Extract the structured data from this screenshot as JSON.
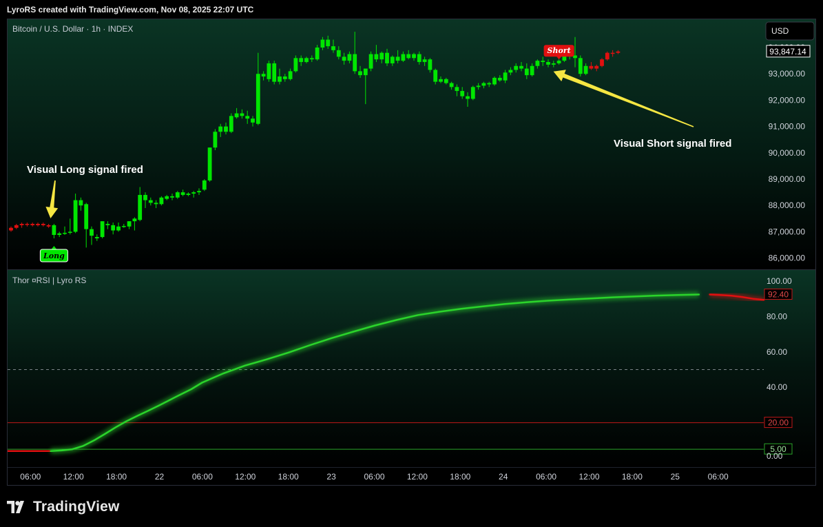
{
  "header": {
    "credit": "LyroRS created with TradingView.com, Nov 08, 2025 22:07 UTC"
  },
  "footer": {
    "brand": "TradingView",
    "logo_icon": "tradingview-logo-icon"
  },
  "colors": {
    "bull": "#00e600",
    "bear": "#e01010",
    "price_label_border": "#ffffff",
    "rsi_green": "#2bd42b",
    "rsi_red": "#e01010",
    "level_red": "#c01818",
    "level_green": "#2aa52a",
    "arrow": "#f5e642"
  },
  "chart_data": [
    {
      "type": "candlestick",
      "title": "Bitcoin / U.S. Dollar · 1h · INDEX",
      "currency_button": "USD",
      "last_price_label": "93,847.14",
      "last_price": 93847.14,
      "ylim": [
        85650,
        94550
      ],
      "yticks": [
        86000,
        87000,
        88000,
        89000,
        90000,
        91000,
        92000,
        93000,
        94000
      ],
      "ytick_labels": [
        "86,000.00",
        "87,000.00",
        "88,000.00",
        "89,000.00",
        "90,000.00",
        "91,000.00",
        "92,000.00",
        "93,000.00",
        "94,000.00"
      ],
      "xlim": [
        0,
        140
      ],
      "xticks": [
        4,
        12,
        20,
        28,
        36,
        44,
        52,
        60,
        68,
        76,
        84,
        92,
        100,
        108,
        116,
        124,
        132
      ],
      "xtick_labels": [
        "06:00",
        "12:00",
        "18:00",
        "22",
        "06:00",
        "12:00",
        "18:00",
        "23",
        "06:00",
        "12:00",
        "18:00",
        "24",
        "06:00",
        "12:00",
        "18:00",
        "25",
        "06:00"
      ],
      "candles": [
        [
          87050,
          87200,
          87000,
          87150,
          "r"
        ],
        [
          87150,
          87300,
          87100,
          87250,
          "r"
        ],
        [
          87250,
          87350,
          87150,
          87300,
          "r"
        ],
        [
          87300,
          87350,
          87200,
          87300,
          "r"
        ],
        [
          87300,
          87350,
          87200,
          87250,
          "r"
        ],
        [
          87250,
          87350,
          87200,
          87300,
          "r"
        ],
        [
          87300,
          87350,
          87200,
          87250,
          "r"
        ],
        [
          87250,
          87300,
          87150,
          87200,
          "r"
        ],
        [
          87250,
          87300,
          86750,
          86880,
          "g"
        ],
        [
          86880,
          87000,
          86800,
          86940,
          "g"
        ],
        [
          86920,
          87200,
          86880,
          86960,
          "g"
        ],
        [
          86960,
          87500,
          86900,
          87000,
          "g"
        ],
        [
          87000,
          88450,
          86950,
          88200,
          "g"
        ],
        [
          88200,
          88300,
          87800,
          88000,
          "g"
        ],
        [
          88050,
          88100,
          86400,
          87100,
          "g"
        ],
        [
          87100,
          87200,
          86500,
          86850,
          "g"
        ],
        [
          86750,
          86900,
          86650,
          86800,
          "g"
        ],
        [
          86800,
          87400,
          86750,
          87400,
          "g"
        ],
        [
          87300,
          87400,
          87100,
          87250,
          "g"
        ],
        [
          87250,
          87350,
          86900,
          87050,
          "g"
        ],
        [
          87050,
          87350,
          87000,
          87200,
          "g"
        ],
        [
          87200,
          87300,
          87150,
          87220,
          "g"
        ],
        [
          87200,
          87400,
          87100,
          87400,
          "g"
        ],
        [
          87400,
          87550,
          87050,
          87500,
          "g"
        ],
        [
          87450,
          88700,
          87400,
          88400,
          "g"
        ],
        [
          88400,
          88500,
          87900,
          88200,
          "g"
        ],
        [
          88200,
          88300,
          88000,
          88100,
          "g"
        ],
        [
          88100,
          88200,
          87900,
          88050,
          "g"
        ],
        [
          88050,
          88350,
          88000,
          88300,
          "g"
        ],
        [
          88250,
          88400,
          88200,
          88350,
          "g"
        ],
        [
          88350,
          88450,
          88200,
          88300,
          "g"
        ],
        [
          88300,
          88550,
          88250,
          88500,
          "g"
        ],
        [
          88500,
          88600,
          88350,
          88400,
          "g"
        ],
        [
          88400,
          88500,
          88350,
          88450,
          "g"
        ],
        [
          88450,
          88550,
          88300,
          88500,
          "g"
        ],
        [
          88500,
          88650,
          88400,
          88550,
          "g"
        ],
        [
          88600,
          89000,
          88550,
          88950,
          "g"
        ],
        [
          88950,
          90200,
          88900,
          90200,
          "g"
        ],
        [
          90200,
          90900,
          90100,
          90800,
          "g"
        ],
        [
          90800,
          91100,
          90600,
          91000,
          "g"
        ],
        [
          91000,
          91150,
          90700,
          90800,
          "g"
        ],
        [
          90800,
          91500,
          90750,
          91400,
          "g"
        ],
        [
          91350,
          91700,
          91300,
          91500,
          "g"
        ],
        [
          91500,
          91650,
          91300,
          91400,
          "g"
        ],
        [
          91400,
          91600,
          91100,
          91300,
          "g"
        ],
        [
          91300,
          91400,
          91000,
          91150,
          "g"
        ],
        [
          91100,
          93800,
          91050,
          93000,
          "g"
        ],
        [
          93000,
          93100,
          92750,
          92900,
          "g"
        ],
        [
          92800,
          93500,
          92700,
          93400,
          "g"
        ],
        [
          93400,
          93500,
          92600,
          92700,
          "g"
        ],
        [
          92700,
          93200,
          92600,
          92900,
          "g"
        ],
        [
          92900,
          93000,
          92700,
          92800,
          "g"
        ],
        [
          92800,
          93200,
          92750,
          93100,
          "g"
        ],
        [
          93100,
          93700,
          93050,
          93600,
          "g"
        ],
        [
          93600,
          93700,
          93300,
          93450,
          "g"
        ],
        [
          93450,
          93650,
          93400,
          93600,
          "g"
        ],
        [
          93600,
          93700,
          93450,
          93550,
          "g"
        ],
        [
          93550,
          94100,
          93500,
          94000,
          "g"
        ],
        [
          94000,
          94400,
          93900,
          94300,
          "g"
        ],
        [
          94300,
          94450,
          93950,
          94050,
          "g"
        ],
        [
          94050,
          94300,
          93800,
          93900,
          "g"
        ],
        [
          93900,
          94050,
          93550,
          93650,
          "g"
        ],
        [
          93650,
          93800,
          93350,
          93500,
          "g"
        ],
        [
          93500,
          93850,
          93400,
          93750,
          "g"
        ],
        [
          93750,
          94600,
          93000,
          93100,
          "g"
        ],
        [
          93100,
          93300,
          92850,
          92950,
          "g"
        ],
        [
          92950,
          93200,
          91850,
          93200,
          "g"
        ],
        [
          93200,
          93850,
          93100,
          93750,
          "g"
        ],
        [
          93750,
          94100,
          93450,
          93550,
          "g"
        ],
        [
          93550,
          93850,
          93400,
          93800,
          "g"
        ],
        [
          93800,
          93950,
          93300,
          93400,
          "g"
        ],
        [
          93400,
          93700,
          93300,
          93650,
          "g"
        ],
        [
          93650,
          93900,
          93400,
          93500,
          "g"
        ],
        [
          93500,
          93850,
          93450,
          93750,
          "g"
        ],
        [
          93750,
          93900,
          93550,
          93600,
          "g"
        ],
        [
          93600,
          93800,
          93500,
          93750,
          "g"
        ],
        [
          93750,
          93850,
          93350,
          93450,
          "g"
        ],
        [
          93450,
          93650,
          93300,
          93550,
          "g"
        ],
        [
          93550,
          93600,
          93050,
          93150,
          "g"
        ],
        [
          93150,
          93200,
          92600,
          92700,
          "g"
        ],
        [
          92700,
          92900,
          92650,
          92800,
          "g"
        ],
        [
          92800,
          92850,
          92600,
          92650,
          "g"
        ],
        [
          92650,
          92700,
          92400,
          92500,
          "g"
        ],
        [
          92500,
          92600,
          92150,
          92350,
          "g"
        ],
        [
          92350,
          92500,
          92050,
          92150,
          "g"
        ],
        [
          92150,
          92300,
          91750,
          92050,
          "g"
        ],
        [
          92050,
          92550,
          92000,
          92500,
          "g"
        ],
        [
          92500,
          92650,
          92400,
          92550,
          "g"
        ],
        [
          92550,
          92700,
          92450,
          92650,
          "g"
        ],
        [
          92650,
          92700,
          92500,
          92600,
          "g"
        ],
        [
          92600,
          92900,
          92550,
          92850,
          "g"
        ],
        [
          92850,
          92950,
          92700,
          92750,
          "g"
        ],
        [
          92750,
          93150,
          92650,
          93050,
          "g"
        ],
        [
          93050,
          93250,
          92950,
          93150,
          "g"
        ],
        [
          93150,
          93400,
          93050,
          93300,
          "g"
        ],
        [
          93300,
          93450,
          93100,
          93200,
          "g"
        ],
        [
          93200,
          93400,
          92800,
          92950,
          "g"
        ],
        [
          92950,
          93400,
          92900,
          93300,
          "g"
        ],
        [
          93300,
          93550,
          93200,
          93500,
          "g"
        ],
        [
          93500,
          93650,
          93300,
          93450,
          "g"
        ],
        [
          93450,
          93550,
          93250,
          93350,
          "g"
        ],
        [
          93350,
          93500,
          93250,
          93400,
          "g"
        ],
        [
          93400,
          93550,
          93350,
          93500,
          "g"
        ],
        [
          93500,
          94050,
          93450,
          93950,
          "g"
        ],
        [
          93950,
          94050,
          93550,
          93700,
          "g"
        ],
        [
          93700,
          94400,
          93250,
          93600,
          "g"
        ],
        [
          93600,
          93700,
          92900,
          93000,
          "g"
        ],
        [
          93000,
          93400,
          92950,
          93300,
          "g"
        ],
        [
          93300,
          93450,
          93150,
          93200,
          "r"
        ],
        [
          93200,
          93350,
          93100,
          93300,
          "r"
        ],
        [
          93300,
          93600,
          93250,
          93550,
          "r"
        ],
        [
          93550,
          93850,
          93500,
          93800,
          "r"
        ],
        [
          93800,
          93900,
          93650,
          93800,
          "r"
        ],
        [
          93800,
          93900,
          93750,
          93850,
          "r"
        ]
      ],
      "signals": [
        {
          "label": "Long",
          "candle": 8,
          "position": "below"
        },
        {
          "label": "Short",
          "candle": 102,
          "position": "above"
        }
      ],
      "annotations": [
        {
          "text": "Visual Long signal fired",
          "candle": 8
        },
        {
          "text": "Visual Short signal fired",
          "candle": 102
        }
      ]
    },
    {
      "type": "line",
      "title": "Thor ¤RSI | Lyro RS",
      "ylim": [
        0,
        100
      ],
      "yticks": [
        0,
        20,
        40,
        60,
        80,
        100
      ],
      "ytick_labels": [
        "0.00",
        "20.00",
        "40.00",
        "60.00",
        "80.00",
        "100.00"
      ],
      "levels": [
        {
          "value": 50,
          "style": "dashed"
        },
        {
          "value": 20,
          "label": "20.00",
          "color": "red"
        },
        {
          "value": 5,
          "label": "5.00",
          "color": "green"
        }
      ],
      "last_value_label": "92.40",
      "last_value": 92.4,
      "series": [
        {
          "x": [
            0,
            8,
            10,
            12,
            14,
            16,
            18,
            20,
            22,
            24,
            26,
            28,
            30,
            32,
            34,
            36,
            38,
            40,
            44,
            48,
            52,
            56,
            60,
            64,
            68,
            72,
            76,
            80,
            84,
            88,
            92,
            96,
            100,
            104,
            108,
            112,
            116,
            120,
            124,
            128,
            130,
            132,
            134,
            136,
            138,
            140
          ],
          "y": [
            4,
            4,
            4.3,
            5,
            6.9,
            10,
            13.6,
            17.4,
            20.8,
            23.8,
            26.7,
            29.7,
            32.8,
            35.9,
            38.9,
            42.6,
            45.3,
            47.9,
            52.3,
            55.8,
            59.6,
            63.8,
            67.8,
            71.4,
            74.9,
            78,
            80.8,
            82.7,
            84.3,
            85.7,
            87,
            88,
            88.9,
            89.6,
            90.2,
            90.8,
            91.3,
            91.8,
            92.1,
            92.4,
            92.4,
            92.1,
            91.7,
            91,
            90,
            89.4
          ],
          "segment_colors": [
            [
              "red",
              0,
              8
            ],
            [
              "green",
              8,
              129
            ],
            [
              "red",
              129,
              140
            ]
          ]
        }
      ]
    }
  ]
}
